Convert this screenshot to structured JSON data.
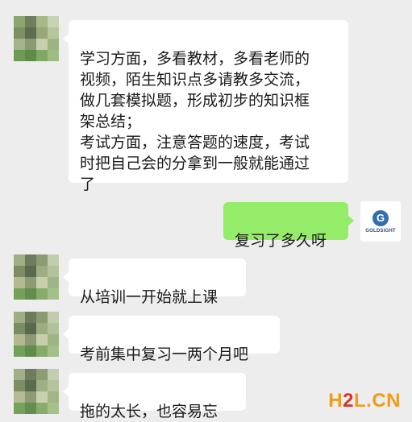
{
  "messages": [
    {
      "side": "left",
      "text": "学习方面，多看教材，多看老师的\n视频，陌生知识点多请教多交流，\n做几套模拟题，形成初步的知识框\n架总结；\n考试方面，注意答题的速度，考试\n时把自己会的分拿到一般就能通过\n了"
    },
    {
      "side": "right",
      "text": "复习了多久呀"
    },
    {
      "side": "left",
      "text": "从培训一开始就上课"
    },
    {
      "side": "left",
      "text": "考前集中复习一两个月吧"
    },
    {
      "side": "left",
      "text": "拖的太长，也容易忘"
    }
  ],
  "logo": {
    "letter": "G",
    "text": "GOLDSIGHT"
  },
  "watermark": {
    "h": "H",
    "two": "2",
    "rest": "L.CN"
  },
  "colors": {
    "background": "#ededed",
    "bubble_self": "#95ec69",
    "bubble_other": "#ffffff",
    "watermark_orange": "#f29a19",
    "watermark_red": "#d9342b"
  }
}
